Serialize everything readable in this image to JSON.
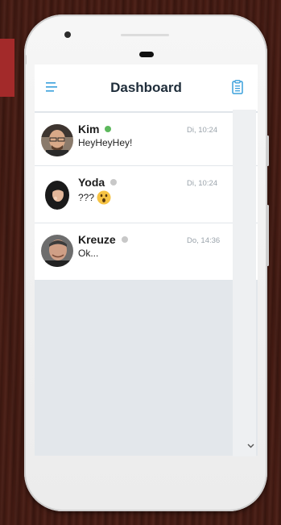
{
  "header": {
    "title": "Dashboard"
  },
  "chats": [
    {
      "name": "Kim",
      "status": "online",
      "status_color": "#5cb85c",
      "message": "HeyHeyHey!",
      "time": "Di, 10:24"
    },
    {
      "name": "Yoda",
      "status": "offline",
      "status_color": "#c8c8c8",
      "message": "???",
      "emoji": "astonished-face",
      "time": "Di, 10:24"
    },
    {
      "name": "Kreuze",
      "status": "offline",
      "status_color": "#c8c8c8",
      "message": "Ok...",
      "time": "Do, 14:36"
    }
  ],
  "colors": {
    "accent": "#3aa0dc",
    "background": "#e3e7eb"
  }
}
